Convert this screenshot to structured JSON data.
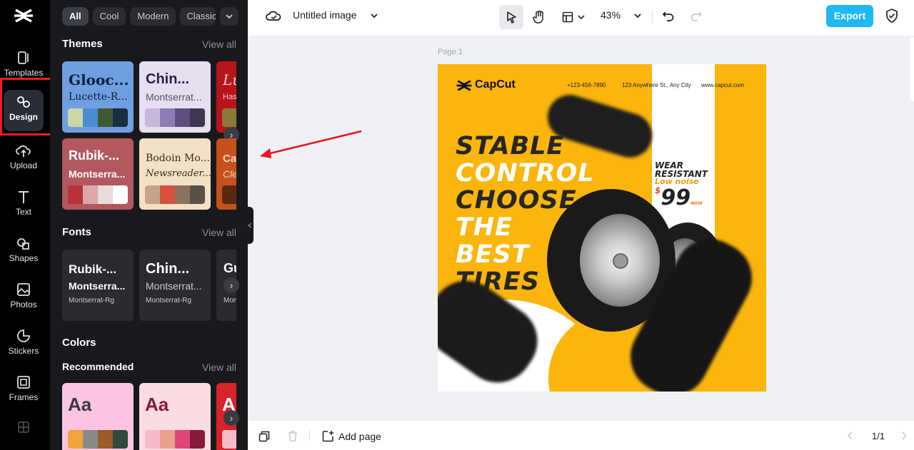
{
  "rail": {
    "items": [
      {
        "label": "Templates"
      },
      {
        "label": "Design"
      },
      {
        "label": "Upload"
      },
      {
        "label": "Text"
      },
      {
        "label": "Shapes"
      },
      {
        "label": "Photos"
      },
      {
        "label": "Stickers"
      },
      {
        "label": "Frames"
      }
    ]
  },
  "panel": {
    "chips": [
      "All",
      "Cool",
      "Modern",
      "Classic"
    ],
    "themes": {
      "title": "Themes",
      "view_all": "View all",
      "cards": [
        {
          "font": "Glooc...",
          "sub": "Lucette-R...",
          "colors": [
            "#c9d7a9",
            "#4a8bd1",
            "#3f5a30",
            "#1a2e3d"
          ]
        },
        {
          "font": "Chin...",
          "sub": "Montserrat...",
          "colors": [
            "#c7b8db",
            "#8c7cb3",
            "#5e4f80",
            "#3f3652"
          ]
        },
        {
          "font": "Lu",
          "sub": "Has",
          "colors": [
            "#8a7a3a",
            "#6a5b2a"
          ]
        },
        {
          "font": "Rubik-...",
          "sub": "Montserra...",
          "colors": [
            "#b8323c",
            "#dba7a7",
            "#e8dcdc",
            "#ffffff"
          ]
        },
        {
          "font": "Bodoin Mo...",
          "sub": "Newsreader...",
          "colors": [
            "#c6a389",
            "#d94f3e",
            "#8a735e",
            "#5a5148"
          ]
        },
        {
          "font": "Ca",
          "sub": "Cle",
          "colors": [
            "#5a2a10",
            "#8a3a12"
          ]
        }
      ]
    },
    "fonts": {
      "title": "Fonts",
      "view_all": "View all",
      "cards": [
        {
          "font": "Rubik-...",
          "sub": "Montserra...",
          "small": "Montserrat-Rg"
        },
        {
          "font": "Chin...",
          "sub": "Montserrat...",
          "small": "Montserrat-Rg"
        },
        {
          "font": "Gu",
          "sub": "",
          "small": "Mon"
        }
      ]
    },
    "colors": {
      "title": "Colors",
      "recommended": "Recommended",
      "view_all": "View all",
      "cards": [
        {
          "aa": "Aa",
          "bg": "#fbc4e3",
          "fg": "#3b3b3b",
          "colors": [
            "#f2a33a",
            "#8a8a8a",
            "#9a5a2a",
            "#2f4a3a"
          ]
        },
        {
          "aa": "Aa",
          "bg": "#f9dde3",
          "fg": "#8a1a3a",
          "colors": [
            "#f6b9c8",
            "#e8a08a",
            "#e0457a",
            "#8a1a3a"
          ]
        },
        {
          "aa": "A",
          "bg": "#d9222a",
          "fg": "#ffffff",
          "colors": [
            "#f6b9c8"
          ]
        }
      ]
    }
  },
  "topbar": {
    "doc_title": "Untitled image",
    "zoom": "43%",
    "export": "Export"
  },
  "bottombar": {
    "add_page": "Add page",
    "page_count": "1/1"
  },
  "canvas": {
    "page_label": "Page 1",
    "poster": {
      "brand": "CapCut",
      "phone": "+123-456-7890",
      "address": "123 Anywhere St., Any City",
      "website": "www.capcut.com",
      "headline": [
        "STABLE",
        "CONTROL",
        "CHOOSE",
        "THE",
        "BEST",
        "TIRES"
      ],
      "wear": "WEAR",
      "resistant": "RESISTANT",
      "low_noise": "Low noise",
      "currency": "$",
      "price": "99",
      "now": "NOW"
    }
  }
}
